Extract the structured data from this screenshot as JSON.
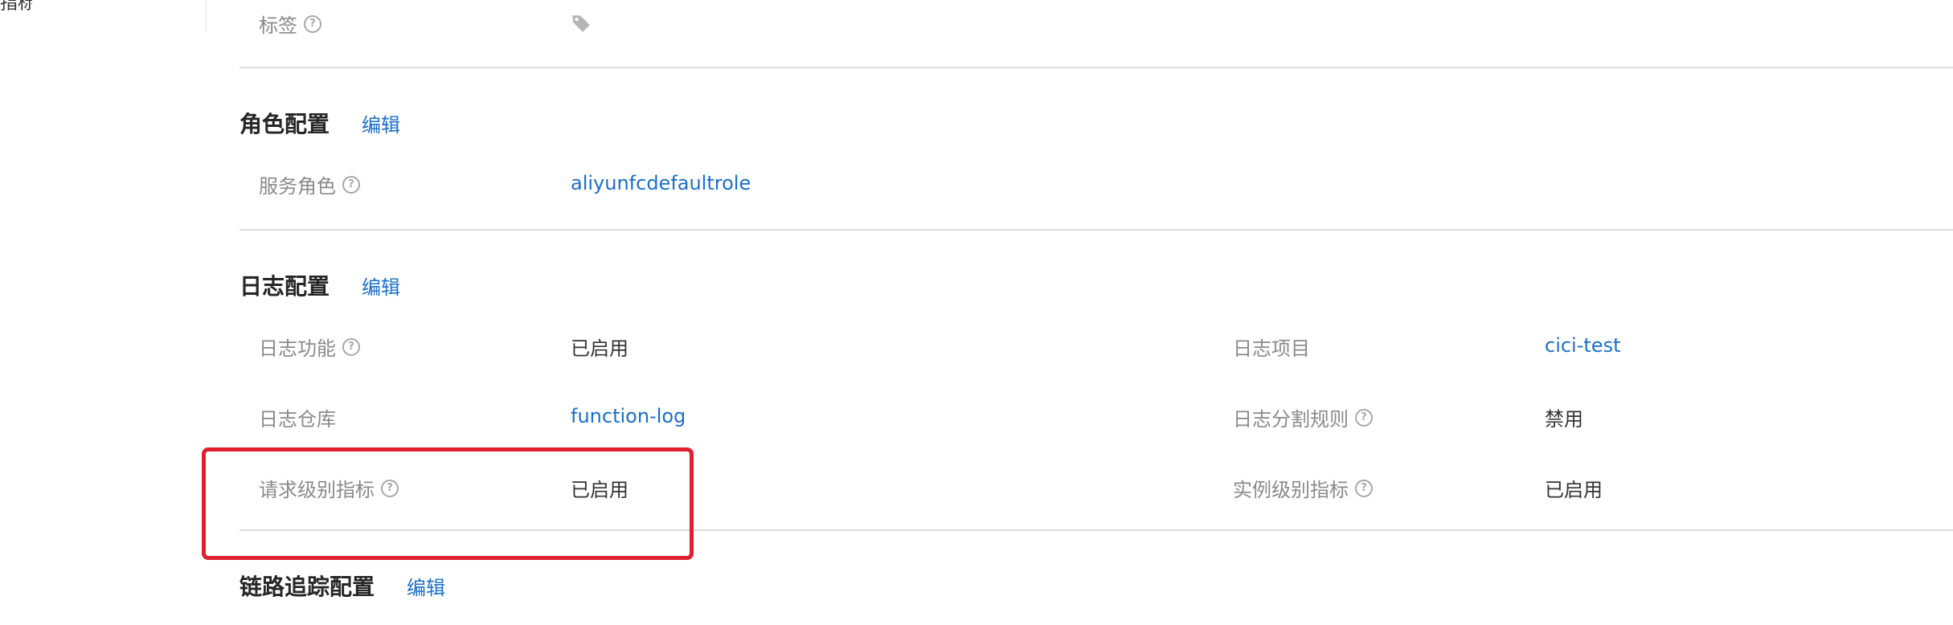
{
  "left_edge": {
    "text": "指标"
  },
  "tags_row": {
    "label": "标签"
  },
  "role_section": {
    "title": "角色配置",
    "edit_label": "编辑",
    "service_role_label": "服务角色",
    "service_role_value": "aliyunfcdefaultrole"
  },
  "log_section": {
    "title": "日志配置",
    "edit_label": "编辑",
    "log_feature_label": "日志功能",
    "log_feature_value": "已启用",
    "log_project_label": "日志项目",
    "log_project_value": "cici-test",
    "logstore_label": "日志仓库",
    "logstore_value": "function-log",
    "split_rule_label": "日志分割规则",
    "split_rule_value": "禁用",
    "request_metrics_label": "请求级别指标",
    "request_metrics_value": "已启用",
    "instance_metrics_label": "实例级别指标",
    "instance_metrics_value": "已启用"
  },
  "tracing_section": {
    "title": "链路追踪配置",
    "edit_label": "编辑"
  },
  "help_icon_glyph": "?",
  "colors": {
    "link": "#1a6fc9",
    "highlight": "#e0202e",
    "label": "#8a8a8a",
    "divider": "#dcdcdc"
  }
}
